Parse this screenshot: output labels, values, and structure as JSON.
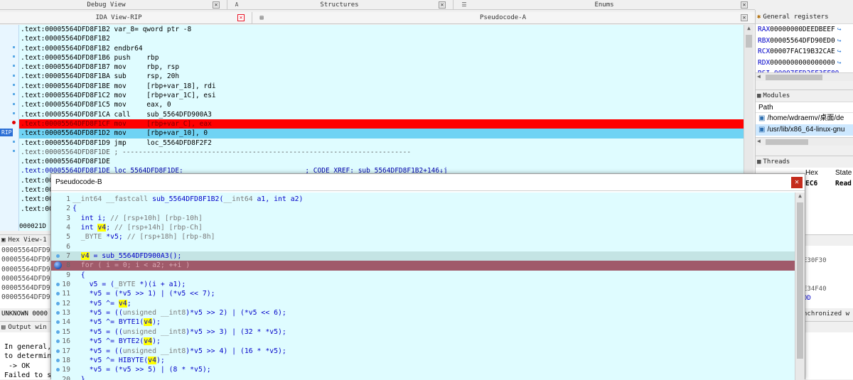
{
  "top_tabs": {
    "debug_view": "Debug View",
    "structures": "Structures",
    "enums": "Enums"
  },
  "second_tabs": {
    "ida_view": "IDA View-RIP",
    "pseudocode_a": "Pseudocode-A"
  },
  "ida_lines": [
    ".text:00005564DFD8F1B2 var_8= qword ptr -8",
    ".text:00005564DFD8F1B2",
    ".text:00005564DFD8F1B2 endbr64",
    ".text:00005564DFD8F1B6 push    rbp",
    ".text:00005564DFD8F1B7 mov     rbp, rsp",
    ".text:00005564DFD8F1BA sub     rsp, 20h",
    ".text:00005564DFD8F1BE mov     [rbp+var_18], rdi",
    ".text:00005564DFD8F1C2 mov     [rbp+var_1C], esi",
    ".text:00005564DFD8F1C5 mov     eax, 0",
    ".text:00005564DFD8F1CA call    sub_5564DFD900A3",
    ".text:00005564DFD8F1CF mov     [rbp+var_C], eax",
    ".text:00005564DFD8F1D2 mov     [rbp+var_10], 0",
    ".text:00005564DFD8F1D9 jmp     loc_5564DFD8F2F2",
    ".text:00005564DFD8F1DE ; -----------------------------------------------------------------------",
    ".text:00005564DFD8F1DE",
    ".text:00005564DFD8F1DE loc_5564DFD8F1DE:                              ; CODE XREF: sub_5564DFD8F1B2+146↓j",
    ".text:00",
    ".text:00",
    ".text:00",
    ".text:00"
  ],
  "ida_status": "000021D",
  "rip_label": "RIP",
  "hex_view": {
    "title": "Hex View-1",
    "rows": [
      "00005564DFD9",
      "00005564DFD9",
      "00005564DFD9",
      "00005564DFD9",
      "00005564DFD9",
      "00005564DFD9"
    ],
    "status": "UNKNOWN 0000",
    "right_fragments": [
      "E30F30",
      "E34F40",
      "0D"
    ],
    "sync_text": "nchronized w"
  },
  "output": {
    "title": "Output win",
    "lines": [
      "In general,",
      "to determin",
      " -> OK",
      "Failed to s"
    ]
  },
  "registers": {
    "title": "General registers",
    "items": [
      {
        "name": "RAX",
        "value": "00000000DEEDBEEF"
      },
      {
        "name": "RBX",
        "value": "00005564DFD90ED0"
      },
      {
        "name": "RCX",
        "value": "00007FAC19B32CAE"
      },
      {
        "name": "RDX",
        "value": "0000000000000000"
      }
    ],
    "partial": "RSI 00007FFD2FF3FF80"
  },
  "modules": {
    "title": "Modules",
    "column": "Path",
    "items": [
      "/home/wdraemv/桌面/de",
      "/usr/lib/x86_64-linux-gnu"
    ]
  },
  "threads": {
    "title": "Threads",
    "col_hex": "Hex",
    "col_state": "State",
    "row_hex": "EC6",
    "row_state": "Read"
  },
  "pseudocode_b": {
    "title": "Pseudocode-B",
    "lines": [
      {
        "n": "1",
        "t": "__int64 __fastcall sub_5564DFD8F1B2(__int64 a1, int a2)"
      },
      {
        "n": "2",
        "t": "{"
      },
      {
        "n": "3",
        "t": "  int i; // [rsp+10h] [rbp-10h]"
      },
      {
        "n": "4",
        "t": "  int v4; // [rsp+14h] [rbp-Ch]"
      },
      {
        "n": "5",
        "t": "  _BYTE *v5; // [rsp+18h] [rbp-8h]"
      },
      {
        "n": "6",
        "t": ""
      },
      {
        "n": "7",
        "t": "  v4 = sub_5564DFD900A3();"
      },
      {
        "n": "8",
        "t": "  for ( i = 0; i < a2; ++i )"
      },
      {
        "n": "9",
        "t": "  {"
      },
      {
        "n": "10",
        "t": "    v5 = (_BYTE *)(i + a1);"
      },
      {
        "n": "11",
        "t": "    *v5 = (*v5 >> 1) | (*v5 << 7);"
      },
      {
        "n": "12",
        "t": "    *v5 ^= v4;"
      },
      {
        "n": "13",
        "t": "    *v5 = ((unsigned __int8)*v5 >> 2) | (*v5 << 6);"
      },
      {
        "n": "14",
        "t": "    *v5 ^= BYTE1(v4);"
      },
      {
        "n": "15",
        "t": "    *v5 = ((unsigned __int8)*v5 >> 3) | (32 * *v5);"
      },
      {
        "n": "16",
        "t": "    *v5 ^= BYTE2(v4);"
      },
      {
        "n": "17",
        "t": "    *v5 = ((unsigned __int8)*v5 >> 4) | (16 * *v5);"
      },
      {
        "n": "18",
        "t": "    *v5 ^= HIBYTE(v4);"
      },
      {
        "n": "19",
        "t": "    *v5 = (*v5 >> 5) | (8 * *v5);"
      },
      {
        "n": "20",
        "t": "  }"
      }
    ]
  },
  "colors": {
    "code_bg": "#dffcff",
    "breakpoint_red": "#ff0000",
    "current_line_blue": "#6fd3f4",
    "highlight_maroon": "#a05a6a",
    "highlight_yellow": "#ffff00"
  }
}
